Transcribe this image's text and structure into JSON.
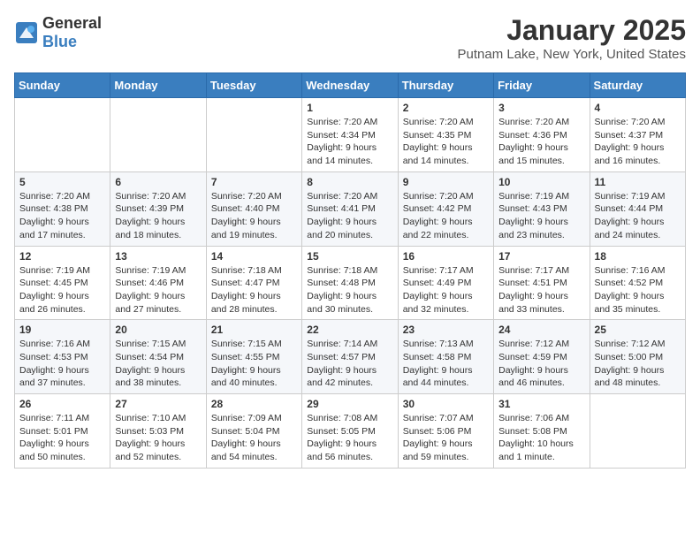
{
  "logo": {
    "general": "General",
    "blue": "Blue"
  },
  "title": "January 2025",
  "location": "Putnam Lake, New York, United States",
  "days_of_week": [
    "Sunday",
    "Monday",
    "Tuesday",
    "Wednesday",
    "Thursday",
    "Friday",
    "Saturday"
  ],
  "weeks": [
    [
      {
        "day": "",
        "sunrise": "",
        "sunset": "",
        "daylight": ""
      },
      {
        "day": "",
        "sunrise": "",
        "sunset": "",
        "daylight": ""
      },
      {
        "day": "",
        "sunrise": "",
        "sunset": "",
        "daylight": ""
      },
      {
        "day": "1",
        "sunrise": "Sunrise: 7:20 AM",
        "sunset": "Sunset: 4:34 PM",
        "daylight": "Daylight: 9 hours and 14 minutes."
      },
      {
        "day": "2",
        "sunrise": "Sunrise: 7:20 AM",
        "sunset": "Sunset: 4:35 PM",
        "daylight": "Daylight: 9 hours and 14 minutes."
      },
      {
        "day": "3",
        "sunrise": "Sunrise: 7:20 AM",
        "sunset": "Sunset: 4:36 PM",
        "daylight": "Daylight: 9 hours and 15 minutes."
      },
      {
        "day": "4",
        "sunrise": "Sunrise: 7:20 AM",
        "sunset": "Sunset: 4:37 PM",
        "daylight": "Daylight: 9 hours and 16 minutes."
      }
    ],
    [
      {
        "day": "5",
        "sunrise": "Sunrise: 7:20 AM",
        "sunset": "Sunset: 4:38 PM",
        "daylight": "Daylight: 9 hours and 17 minutes."
      },
      {
        "day": "6",
        "sunrise": "Sunrise: 7:20 AM",
        "sunset": "Sunset: 4:39 PM",
        "daylight": "Daylight: 9 hours and 18 minutes."
      },
      {
        "day": "7",
        "sunrise": "Sunrise: 7:20 AM",
        "sunset": "Sunset: 4:40 PM",
        "daylight": "Daylight: 9 hours and 19 minutes."
      },
      {
        "day": "8",
        "sunrise": "Sunrise: 7:20 AM",
        "sunset": "Sunset: 4:41 PM",
        "daylight": "Daylight: 9 hours and 20 minutes."
      },
      {
        "day": "9",
        "sunrise": "Sunrise: 7:20 AM",
        "sunset": "Sunset: 4:42 PM",
        "daylight": "Daylight: 9 hours and 22 minutes."
      },
      {
        "day": "10",
        "sunrise": "Sunrise: 7:19 AM",
        "sunset": "Sunset: 4:43 PM",
        "daylight": "Daylight: 9 hours and 23 minutes."
      },
      {
        "day": "11",
        "sunrise": "Sunrise: 7:19 AM",
        "sunset": "Sunset: 4:44 PM",
        "daylight": "Daylight: 9 hours and 24 minutes."
      }
    ],
    [
      {
        "day": "12",
        "sunrise": "Sunrise: 7:19 AM",
        "sunset": "Sunset: 4:45 PM",
        "daylight": "Daylight: 9 hours and 26 minutes."
      },
      {
        "day": "13",
        "sunrise": "Sunrise: 7:19 AM",
        "sunset": "Sunset: 4:46 PM",
        "daylight": "Daylight: 9 hours and 27 minutes."
      },
      {
        "day": "14",
        "sunrise": "Sunrise: 7:18 AM",
        "sunset": "Sunset: 4:47 PM",
        "daylight": "Daylight: 9 hours and 28 minutes."
      },
      {
        "day": "15",
        "sunrise": "Sunrise: 7:18 AM",
        "sunset": "Sunset: 4:48 PM",
        "daylight": "Daylight: 9 hours and 30 minutes."
      },
      {
        "day": "16",
        "sunrise": "Sunrise: 7:17 AM",
        "sunset": "Sunset: 4:49 PM",
        "daylight": "Daylight: 9 hours and 32 minutes."
      },
      {
        "day": "17",
        "sunrise": "Sunrise: 7:17 AM",
        "sunset": "Sunset: 4:51 PM",
        "daylight": "Daylight: 9 hours and 33 minutes."
      },
      {
        "day": "18",
        "sunrise": "Sunrise: 7:16 AM",
        "sunset": "Sunset: 4:52 PM",
        "daylight": "Daylight: 9 hours and 35 minutes."
      }
    ],
    [
      {
        "day": "19",
        "sunrise": "Sunrise: 7:16 AM",
        "sunset": "Sunset: 4:53 PM",
        "daylight": "Daylight: 9 hours and 37 minutes."
      },
      {
        "day": "20",
        "sunrise": "Sunrise: 7:15 AM",
        "sunset": "Sunset: 4:54 PM",
        "daylight": "Daylight: 9 hours and 38 minutes."
      },
      {
        "day": "21",
        "sunrise": "Sunrise: 7:15 AM",
        "sunset": "Sunset: 4:55 PM",
        "daylight": "Daylight: 9 hours and 40 minutes."
      },
      {
        "day": "22",
        "sunrise": "Sunrise: 7:14 AM",
        "sunset": "Sunset: 4:57 PM",
        "daylight": "Daylight: 9 hours and 42 minutes."
      },
      {
        "day": "23",
        "sunrise": "Sunrise: 7:13 AM",
        "sunset": "Sunset: 4:58 PM",
        "daylight": "Daylight: 9 hours and 44 minutes."
      },
      {
        "day": "24",
        "sunrise": "Sunrise: 7:12 AM",
        "sunset": "Sunset: 4:59 PM",
        "daylight": "Daylight: 9 hours and 46 minutes."
      },
      {
        "day": "25",
        "sunrise": "Sunrise: 7:12 AM",
        "sunset": "Sunset: 5:00 PM",
        "daylight": "Daylight: 9 hours and 48 minutes."
      }
    ],
    [
      {
        "day": "26",
        "sunrise": "Sunrise: 7:11 AM",
        "sunset": "Sunset: 5:01 PM",
        "daylight": "Daylight: 9 hours and 50 minutes."
      },
      {
        "day": "27",
        "sunrise": "Sunrise: 7:10 AM",
        "sunset": "Sunset: 5:03 PM",
        "daylight": "Daylight: 9 hours and 52 minutes."
      },
      {
        "day": "28",
        "sunrise": "Sunrise: 7:09 AM",
        "sunset": "Sunset: 5:04 PM",
        "daylight": "Daylight: 9 hours and 54 minutes."
      },
      {
        "day": "29",
        "sunrise": "Sunrise: 7:08 AM",
        "sunset": "Sunset: 5:05 PM",
        "daylight": "Daylight: 9 hours and 56 minutes."
      },
      {
        "day": "30",
        "sunrise": "Sunrise: 7:07 AM",
        "sunset": "Sunset: 5:06 PM",
        "daylight": "Daylight: 9 hours and 59 minutes."
      },
      {
        "day": "31",
        "sunrise": "Sunrise: 7:06 AM",
        "sunset": "Sunset: 5:08 PM",
        "daylight": "Daylight: 10 hours and 1 minute."
      },
      {
        "day": "",
        "sunrise": "",
        "sunset": "",
        "daylight": ""
      }
    ]
  ]
}
